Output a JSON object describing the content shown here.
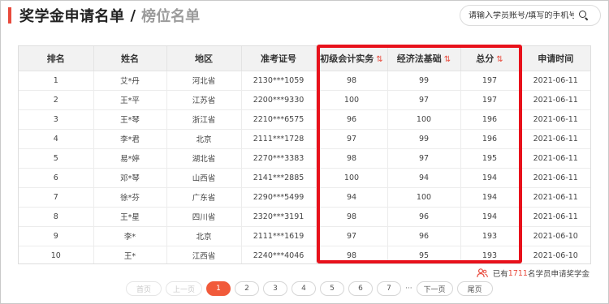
{
  "header": {
    "title": "奖学金申请名单",
    "separator": "/",
    "subtitle": "榜位名单"
  },
  "search": {
    "placeholder": "请输入学员账号/填写的手机号"
  },
  "table": {
    "columns": [
      "排名",
      "姓名",
      "地区",
      "准考证号",
      "初级会计实务",
      "经济法基础",
      "总分",
      "申请时间"
    ],
    "sortable": [
      "初级会计实务",
      "经济法基础",
      "总分"
    ],
    "sort_glyph": "⇅",
    "rows": [
      [
        "1",
        "艾*丹",
        "河北省",
        "2130***1059",
        "98",
        "99",
        "197",
        "2021-06-11"
      ],
      [
        "2",
        "王*平",
        "江苏省",
        "2200***9330",
        "100",
        "97",
        "197",
        "2021-06-11"
      ],
      [
        "3",
        "王*琴",
        "浙江省",
        "2210***6575",
        "96",
        "100",
        "196",
        "2021-06-11"
      ],
      [
        "4",
        "李*君",
        "北京",
        "2111***1728",
        "97",
        "99",
        "196",
        "2021-06-11"
      ],
      [
        "5",
        "易*婷",
        "湖北省",
        "2270***3383",
        "98",
        "97",
        "195",
        "2021-06-11"
      ],
      [
        "6",
        "邓*琴",
        "山西省",
        "2141***2885",
        "100",
        "94",
        "194",
        "2021-06-11"
      ],
      [
        "7",
        "徐*芬",
        "广东省",
        "2290***5499",
        "94",
        "100",
        "194",
        "2021-06-11"
      ],
      [
        "8",
        "王*星",
        "四川省",
        "2320***3191",
        "98",
        "96",
        "194",
        "2021-06-11"
      ],
      [
        "9",
        "李*",
        "北京",
        "2111***1619",
        "97",
        "96",
        "193",
        "2021-06-10"
      ],
      [
        "10",
        "王*",
        "江西省",
        "2240***4046",
        "98",
        "95",
        "193",
        "2021-06-10"
      ]
    ]
  },
  "note": {
    "prefix": "已有",
    "count": "1711",
    "suffix": "名学员申请奖学金"
  },
  "pagination": {
    "first": "首页",
    "prev": "上一页",
    "pages": [
      "1",
      "2",
      "3",
      "4",
      "5",
      "6",
      "7"
    ],
    "current": "1",
    "ellipsis": "···",
    "next": "下一页",
    "last": "尾页"
  },
  "colors": {
    "accent": "#e84a3c",
    "highlight_border": "#e8111b",
    "active_page": "#f15a3a"
  },
  "icons": {
    "search": "search-icon",
    "sort": "sort-icon",
    "users": "users-icon"
  }
}
